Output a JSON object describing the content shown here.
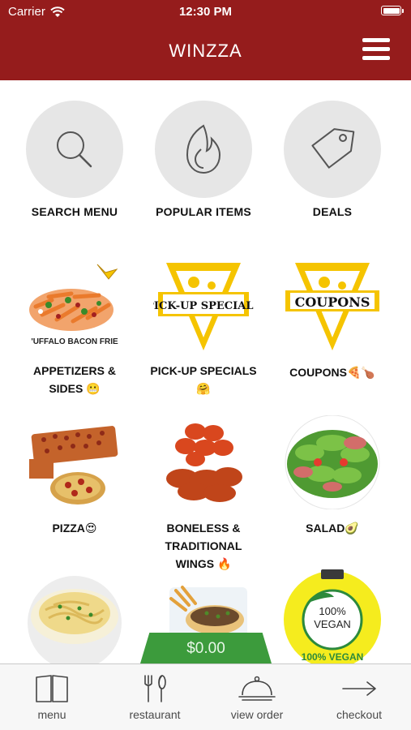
{
  "status_bar": {
    "carrier": "Carrier",
    "time": "12:30 PM"
  },
  "header": {
    "title": "WINZZA"
  },
  "quick_actions": [
    {
      "label": "SEARCH MENU",
      "icon": "search-icon"
    },
    {
      "label": "POPULAR ITEMS",
      "icon": "flame-icon"
    },
    {
      "label": "DEALS",
      "icon": "tag-icon"
    }
  ],
  "categories": [
    {
      "line1": "APPETIZERS &",
      "line2": "SIDES 😬",
      "image_text": "'UFFALO BACON FRIE"
    },
    {
      "line1": "PICK-UP SPECIALS",
      "line2": "🤗",
      "image_text": "PICK-UP SPECIALS"
    },
    {
      "line1": "COUPONS🍕🍗",
      "line2": "",
      "image_text": "COUPONS"
    },
    {
      "line1": "PIZZA😍",
      "line2": ""
    },
    {
      "line1": "BONELESS &",
      "line2": "TRADITIONAL",
      "line3": "WINGS 🔥"
    },
    {
      "line1": "SALAD🥑",
      "line2": ""
    },
    {
      "line1": "",
      "line2": ""
    },
    {
      "line1": "",
      "line2": ""
    },
    {
      "line1": "",
      "line2": "",
      "image_text_1": "100%",
      "image_text_2": "VEGAN",
      "image_text_3": "100% VEGAN"
    }
  ],
  "order_total": "$0.00",
  "tabs": [
    {
      "label": "menu",
      "icon": "book-icon"
    },
    {
      "label": "restaurant",
      "icon": "fork-knife-icon"
    },
    {
      "label": "view order",
      "icon": "cloche-icon"
    },
    {
      "label": "checkout",
      "icon": "arrow-right-icon"
    }
  ],
  "colors": {
    "header": "#951c1c",
    "total": "#3c9b3c",
    "circle": "#e6e6e6",
    "logo_yellow": "#f5c400"
  }
}
